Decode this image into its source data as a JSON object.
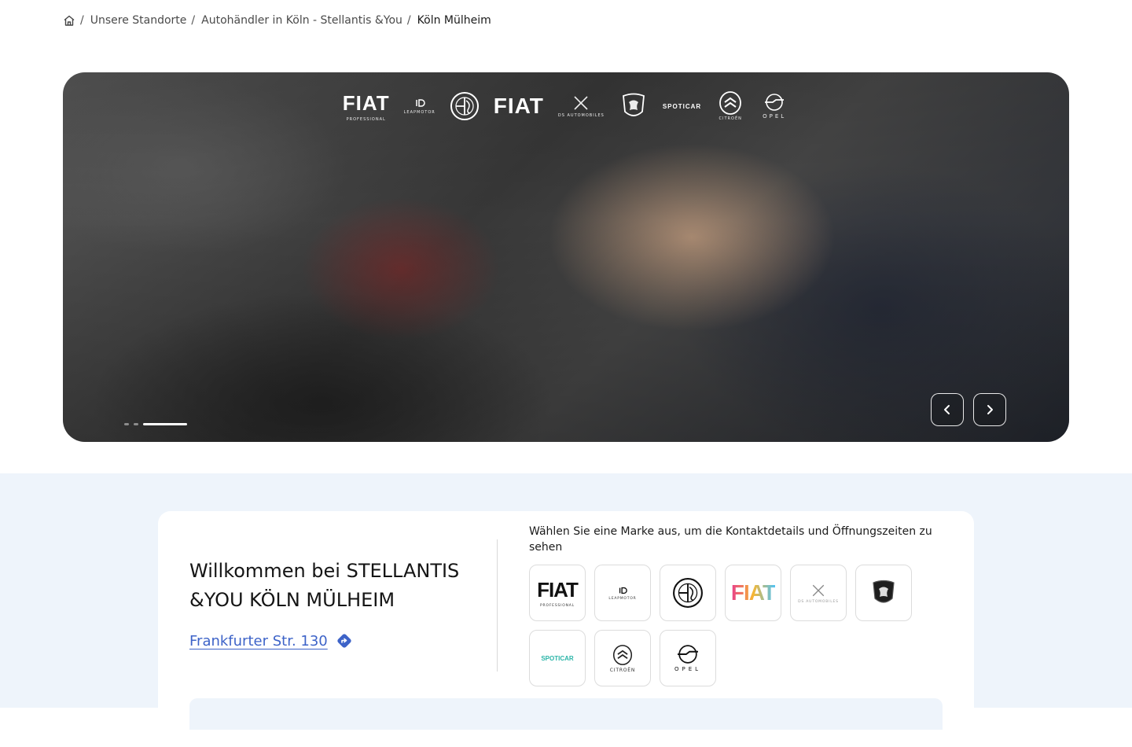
{
  "breadcrumb": {
    "home_icon": "home-icon",
    "items": [
      {
        "label": "Unsere Standorte"
      },
      {
        "label": "Autohändler in Köln - Stellantis &You"
      }
    ],
    "current": "Köln Mülheim",
    "separator": "/"
  },
  "hero": {
    "logos": [
      {
        "name": "fiat-professional-logo",
        "text": "FIAT",
        "sub": "PROFESSIONAL"
      },
      {
        "name": "leapmotor-logo",
        "text": "",
        "sub": "LEAPMOTOR"
      },
      {
        "name": "alfa-romeo-logo",
        "text": "",
        "sub": ""
      },
      {
        "name": "fiat-logo",
        "text": "FIAT",
        "sub": ""
      },
      {
        "name": "ds-automobiles-logo",
        "text": "",
        "sub": "DS AUTOMOBILES"
      },
      {
        "name": "peugeot-logo",
        "text": "",
        "sub": ""
      },
      {
        "name": "spoticar-logo",
        "text": "SPOTICAR",
        "sub": ""
      },
      {
        "name": "citroen-logo",
        "text": "",
        "sub": "CITROËN"
      },
      {
        "name": "opel-logo",
        "text": "",
        "sub": "OPEL"
      }
    ],
    "slides_total": 3,
    "active_slide": 3,
    "prev_icon": "chevron-left-icon",
    "next_icon": "chevron-right-icon"
  },
  "dealer": {
    "welcome": "Willkommen bei STELLANTIS &YOU KÖLN MÜLHEIM",
    "address": "Frankfurter Str. 130",
    "directions_icon": "directions-icon"
  },
  "brands": {
    "prompt": "Wählen Sie eine Marke aus, um die Kontaktdetails und Öffnungszeiten zu sehen",
    "tiles": [
      {
        "name": "fiat-professional",
        "text": "FIAT",
        "sub": "PROFESSIONAL"
      },
      {
        "name": "leapmotor",
        "text": "",
        "sub": "LEAPMOTOR"
      },
      {
        "name": "alfa-romeo",
        "text": "",
        "sub": ""
      },
      {
        "name": "fiat",
        "text": "FIAT",
        "sub": ""
      },
      {
        "name": "ds-automobiles",
        "text": "",
        "sub": "DS AUTOMOBILES"
      },
      {
        "name": "peugeot",
        "text": "",
        "sub": ""
      },
      {
        "name": "spoticar",
        "text": "SPOTICAR",
        "sub": ""
      },
      {
        "name": "citroen",
        "text": "",
        "sub": "CITROËN"
      },
      {
        "name": "opel",
        "text": "",
        "sub": "OPEL"
      }
    ]
  },
  "colors": {
    "link": "#3d63c8",
    "section_bg": "#eef4fb",
    "fiat_gradient": [
      "#e83e8c",
      "#f7b733",
      "#4fc3f7"
    ],
    "spoticar_accent": "#2bb5a8"
  }
}
